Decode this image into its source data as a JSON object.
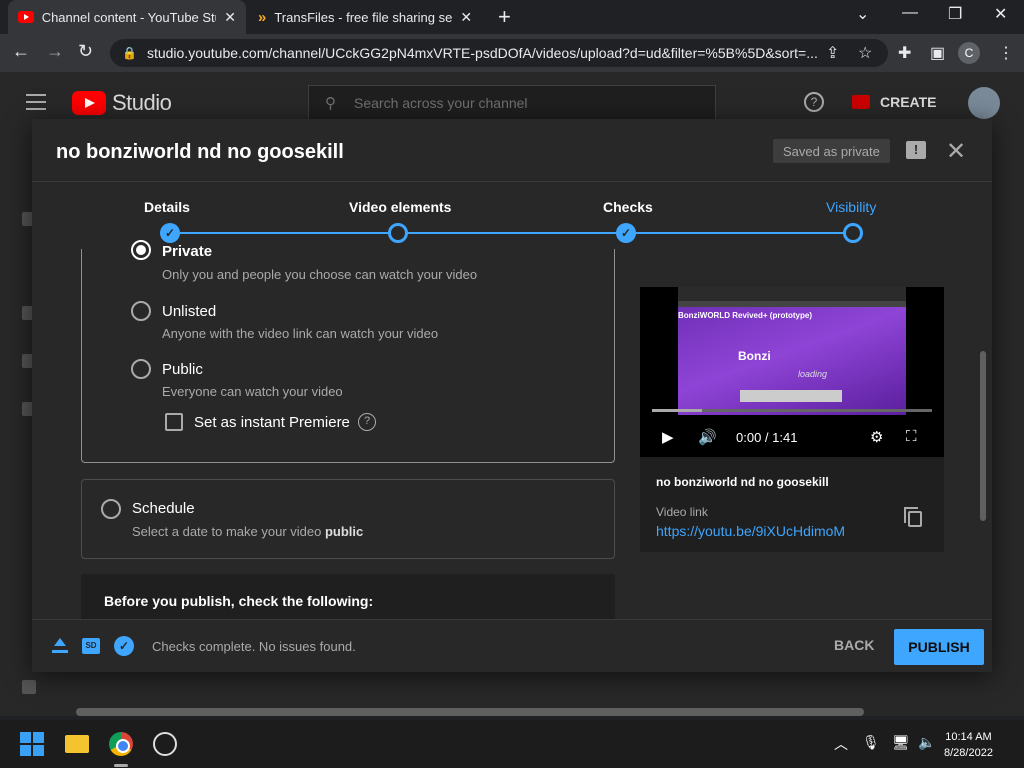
{
  "browser": {
    "tabs": [
      {
        "title": "Channel content - YouTube Studio",
        "favicon": "youtube-favicon"
      },
      {
        "title": "TransFiles - free file sharing service",
        "favicon": "transfiles-favicon"
      }
    ],
    "url": "studio.youtube.com/channel/UCckGG2pN4mxVRTE-psdDOfA/videos/upload?d=ud&filter=%5B%5D&sort=...",
    "profile_initial": "C"
  },
  "studio": {
    "logo_text": "Studio",
    "search_placeholder": "Search across your channel",
    "create_label": "CREATE"
  },
  "modal": {
    "title": "no bonziworld nd no goosekill",
    "saved_badge": "Saved as private",
    "steps": [
      {
        "label": "Details",
        "state": "done"
      },
      {
        "label": "Video elements",
        "state": "todo"
      },
      {
        "label": "Checks",
        "state": "done"
      },
      {
        "label": "Visibility",
        "state": "current"
      }
    ],
    "visibility": {
      "private": {
        "title": "Private",
        "desc": "Only you and people you choose can watch your video"
      },
      "unlisted": {
        "title": "Unlisted",
        "desc": "Anyone with the video link can watch your video"
      },
      "public": {
        "title": "Public",
        "desc": "Everyone can watch your video"
      },
      "premiere_label": "Set as instant Premiere"
    },
    "schedule": {
      "title": "Schedule",
      "desc_prefix": "Select a date to make your video ",
      "desc_bold": "public"
    },
    "before_publish": "Before you publish, check the following:",
    "preview": {
      "time": "0:00 / 1:41",
      "progress": 0.18,
      "thumb_title": "BonziWORLD Revived+ (prototype)",
      "thumb_logo": "Bonzi",
      "thumb_loading": "loading",
      "video_title": "no bonziworld nd no goosekill",
      "link_label": "Video link",
      "link": "https://youtu.be/9iXUcHdimoM"
    },
    "footer": {
      "sd_badge": "SD",
      "checks_text": "Checks complete. No issues found.",
      "back_label": "BACK",
      "publish_label": "PUBLISH"
    }
  },
  "taskbar": {
    "time": "10:14 AM",
    "date": "8/28/2022"
  },
  "colors": {
    "accent": "#3ea6ff",
    "background": "#282828",
    "brand_red": "#ff0000"
  }
}
